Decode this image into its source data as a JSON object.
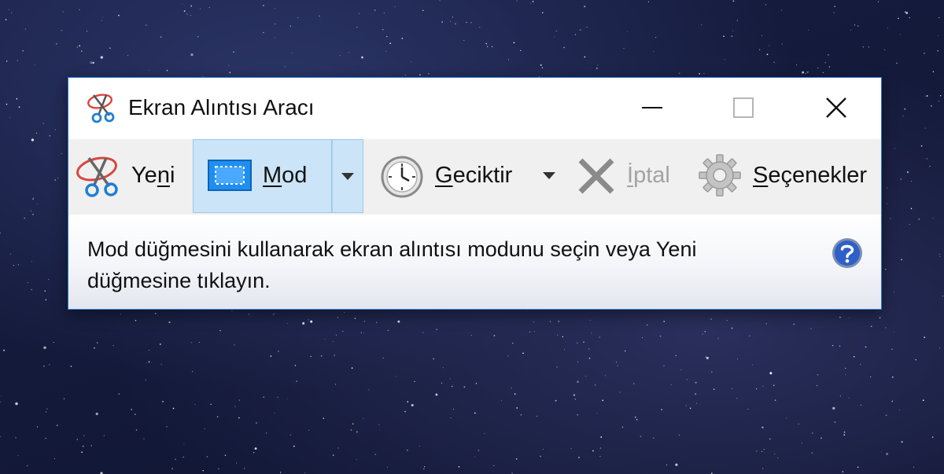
{
  "window": {
    "title": "Ekran Alıntısı Aracı",
    "controls": {
      "minimize": "minimize-icon",
      "maximize": "maximize-icon",
      "close": "close-icon"
    }
  },
  "toolbar": {
    "new": {
      "label_pre": "Ye",
      "label_key": "n",
      "label_post": "i",
      "icon": "snipping-scissors-icon"
    },
    "mode": {
      "label_key": "M",
      "label_post": "od",
      "icon": "rectangle-snip-icon",
      "dropdown_icon": "chevron-down-icon",
      "active": true
    },
    "delay": {
      "label_key": "G",
      "label_post": "eciktir",
      "icon": "clock-icon",
      "dropdown_icon": "chevron-down-icon"
    },
    "cancel": {
      "label_key": "İ",
      "label_post": "ptal",
      "icon": "cancel-x-icon",
      "disabled": true
    },
    "options": {
      "label_key": "S",
      "label_post": "eçenekler",
      "icon": "gear-icon"
    }
  },
  "info": {
    "message": "Mod düğmesini kullanarak ekran alıntısı modunu seçin veya Yeni düğmesine tıklayın.",
    "help_icon": "help-icon"
  },
  "colors": {
    "accent_border": "#2b7ad6",
    "toolbar_bg": "#f0f0f0",
    "mode_highlight": "#cce4f7",
    "disabled_text": "#a3a3a3"
  }
}
